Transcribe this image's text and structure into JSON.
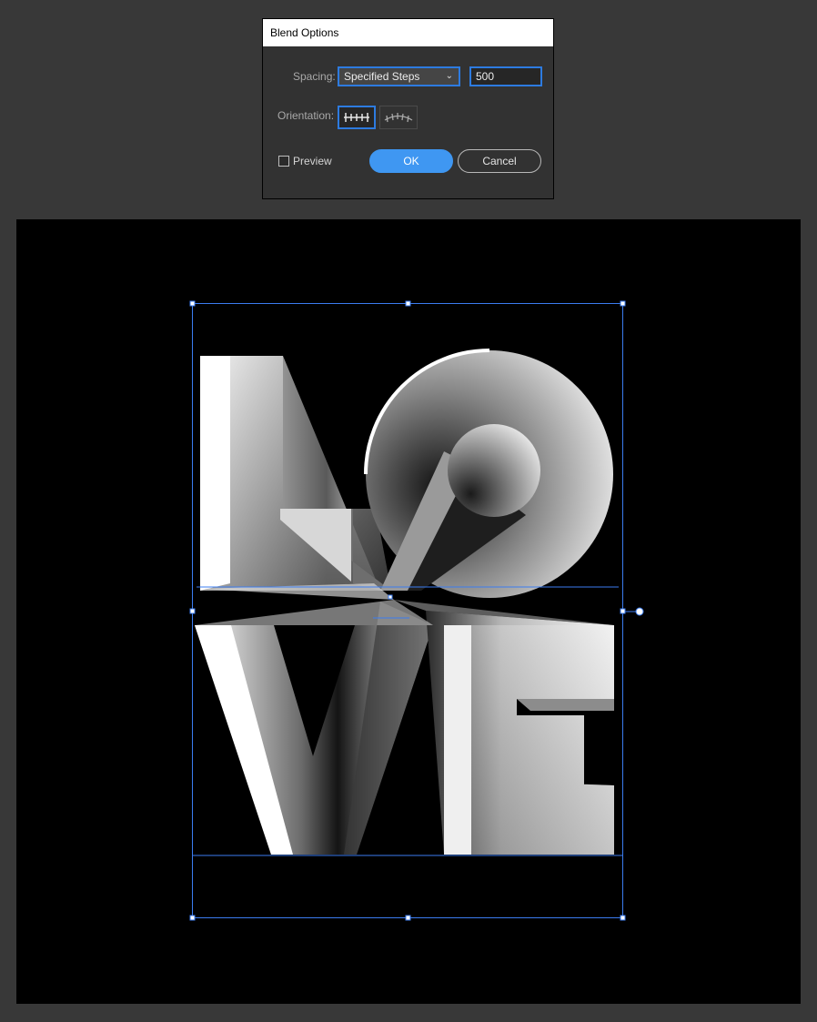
{
  "dialog": {
    "title": "Blend Options",
    "spacing_label": "Spacing:",
    "spacing_value": "Specified Steps",
    "steps_value": "500",
    "orientation_label": "Orientation:",
    "preview_label": "Preview",
    "preview_checked": false,
    "ok_label": "OK",
    "cancel_label": "Cancel"
  },
  "artwork": {
    "letters": [
      "L",
      "O",
      "V",
      "E"
    ],
    "accent_color": "#3f97f2",
    "selection_color": "#3b7cf0"
  }
}
